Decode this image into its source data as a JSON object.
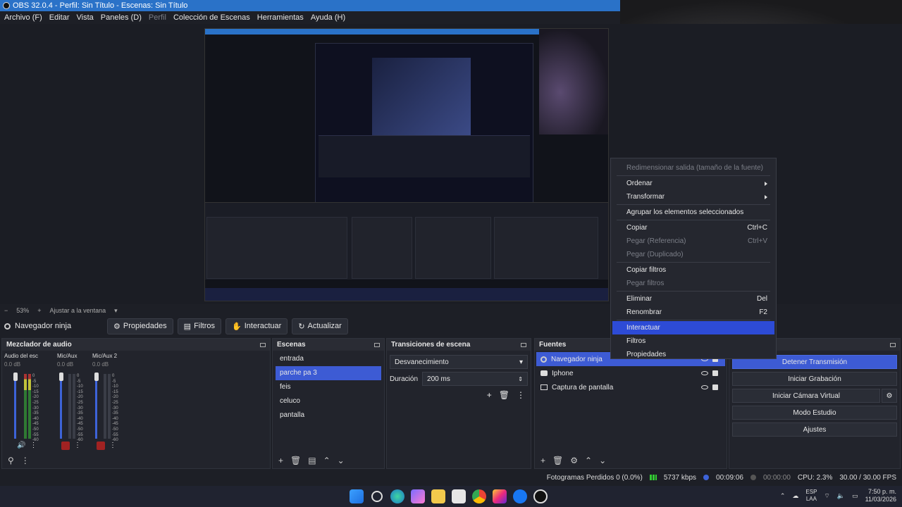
{
  "window": {
    "title": "OBS 32.0.4 - Perfil: Sin Título - Escenas: Sin Título"
  },
  "menu": [
    {
      "label": "Archivo (F)",
      "enabled": true
    },
    {
      "label": "Editar",
      "enabled": true
    },
    {
      "label": "Vista",
      "enabled": true
    },
    {
      "label": "Paneles (D)",
      "enabled": true
    },
    {
      "label": "Perfil",
      "enabled": false
    },
    {
      "label": "Colección de Escenas",
      "enabled": true
    },
    {
      "label": "Herramientas",
      "enabled": true
    },
    {
      "label": "Ayuda (H)",
      "enabled": true
    }
  ],
  "zoom": {
    "minus": "−",
    "value": "53%",
    "plus": "+",
    "fit": "Ajustar a la ventana"
  },
  "toolbar": {
    "source_name": "Navegador ninja",
    "properties": "Propiedades",
    "filters": "Filtros",
    "interact": "Interactuar",
    "refresh": "Actualizar"
  },
  "mixer": {
    "title": "Mezclador de audio",
    "channels": [
      {
        "name": "Audio del escritorio",
        "db": "0.0 dB"
      },
      {
        "name": "Mic/Aux",
        "db": "0.0 dB"
      },
      {
        "name": "Mic/Aux 2",
        "db": "0.0 dB"
      }
    ],
    "scale": [
      "0",
      "-5",
      "-10",
      "-15",
      "-20",
      "-25",
      "-30",
      "-35",
      "-40",
      "-45",
      "-50",
      "-55",
      "-60"
    ]
  },
  "scenes": {
    "title": "Escenas",
    "items": [
      "entrada",
      "parche pa 3",
      "feis",
      "celuco",
      "pantalla"
    ],
    "selected": 1
  },
  "transitions": {
    "title": "Transiciones de escena",
    "type": "Desvanecimiento",
    "duration_label": "Duración",
    "duration_value": "200 ms"
  },
  "sources": {
    "title": "Fuentes",
    "items": [
      {
        "name": "Navegador ninja",
        "icon": "globe-icon"
      },
      {
        "name": "Iphone",
        "icon": "camera-icon"
      },
      {
        "name": "Captura de pantalla",
        "icon": "monitor-icon"
      }
    ],
    "selected": 0
  },
  "controls": {
    "stop_stream": "Detener Transmisión",
    "start_record": "Iniciar Grabación",
    "virtual_cam": "Iniciar Cámara Virtual",
    "studio_mode": "Modo Estudio",
    "settings": "Ajustes"
  },
  "context_menu": {
    "resize": "Redimensionar salida (tamaño de la fuente)",
    "order": "Ordenar",
    "transform": "Transformar",
    "group": "Agrupar los elementos seleccionados",
    "copy": "Copiar",
    "copy_shortcut": "Ctrl+C",
    "paste_ref": "Pegar (Referencia)",
    "paste_ref_shortcut": "Ctrl+V",
    "paste_dup": "Pegar (Duplicado)",
    "copy_filters": "Copiar filtros",
    "paste_filters": "Pegar filtros",
    "remove": "Eliminar",
    "remove_shortcut": "Del",
    "rename": "Renombrar",
    "rename_shortcut": "F2",
    "interact": "Interactuar",
    "filters": "Filtros",
    "properties": "Propiedades"
  },
  "status": {
    "dropped": "Fotogramas Perdidos 0 (0.0%)",
    "bitrate": "5737 kbps",
    "stream_time": "00:09:06",
    "rec_time": "00:00:00",
    "cpu": "CPU: 2.3%",
    "fps": "30.00 / 30.00 FPS"
  },
  "tray": {
    "lang1": "ESP",
    "lang2": "LAA",
    "time": "7:50 p. m.",
    "date": "11/03/2026"
  },
  "colors": {
    "accent": "#3d5bd4",
    "titlebar": "#2a72c8",
    "panel": "#22242c"
  }
}
